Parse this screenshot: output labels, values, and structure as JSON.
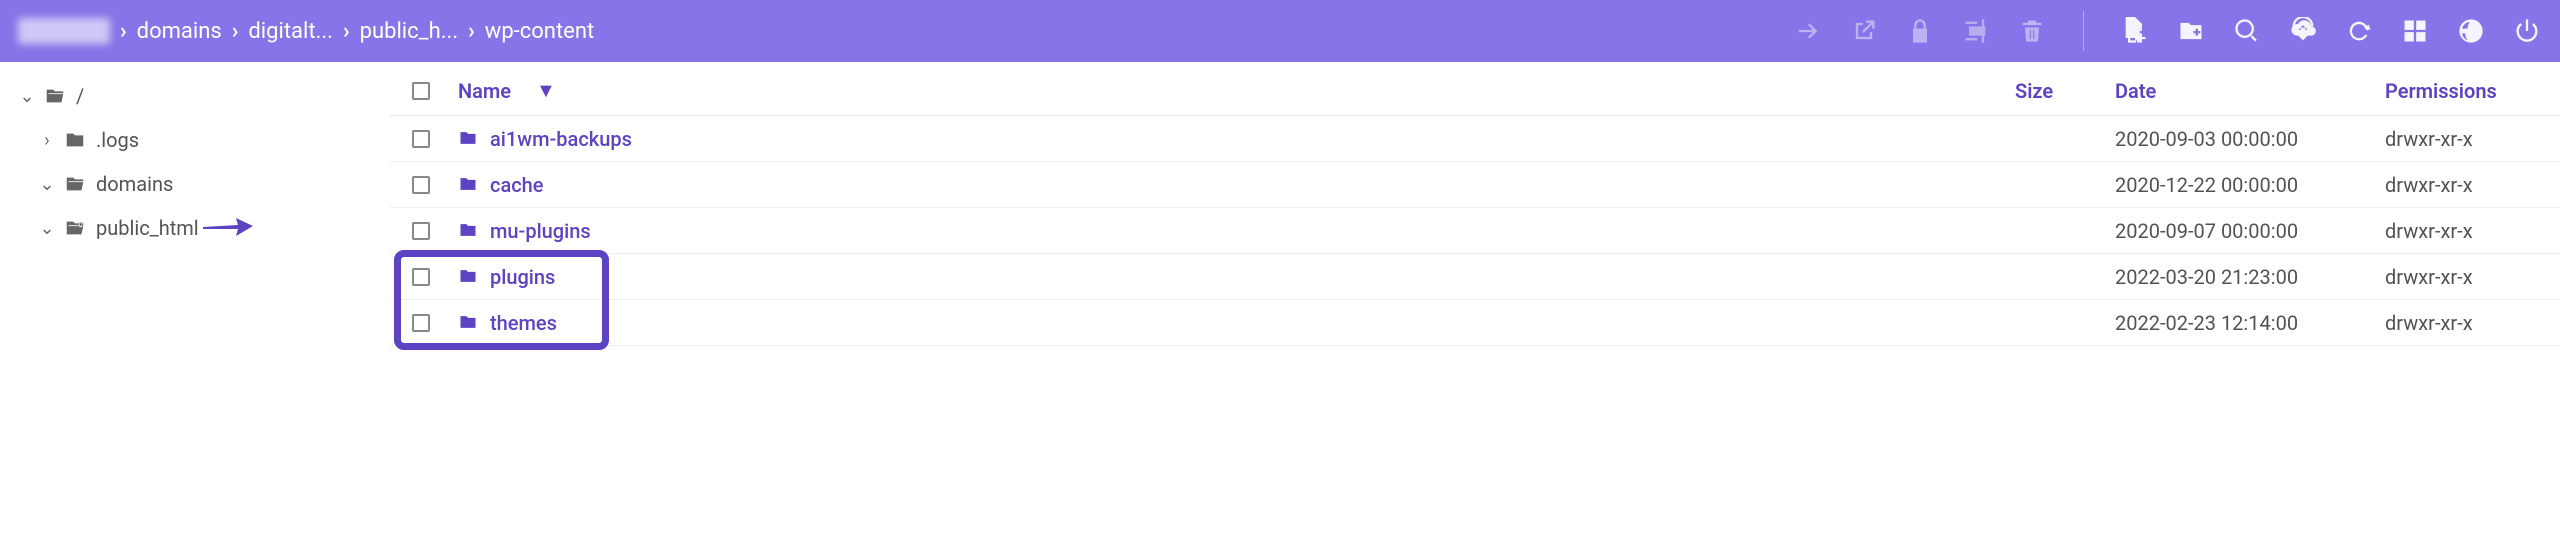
{
  "breadcrumbs": [
    "domains",
    "digitalt...",
    "public_h...",
    "wp-content"
  ],
  "tree": [
    {
      "toggle": "down",
      "icon": "folder-open",
      "label": "/",
      "indent": 0
    },
    {
      "toggle": "right",
      "icon": "folder",
      "label": ".logs",
      "indent": 1
    },
    {
      "toggle": "down",
      "icon": "folder-open",
      "label": "domains",
      "indent": 1
    },
    {
      "toggle": "down",
      "icon": "folder-open-link",
      "label": "public_html",
      "indent": 1,
      "arrow": true
    }
  ],
  "columns": {
    "name": "Name",
    "size": "Size",
    "date": "Date",
    "perm": "Permissions",
    "sort_indicator": "▼"
  },
  "rows": [
    {
      "name": "ai1wm-backups",
      "size": "",
      "date": "2020-09-03 00:00:00",
      "perm": "drwxr-xr-x"
    },
    {
      "name": "cache",
      "size": "",
      "date": "2020-12-22 00:00:00",
      "perm": "drwxr-xr-x"
    },
    {
      "name": "mu-plugins",
      "size": "",
      "date": "2020-09-07 00:00:00",
      "perm": "drwxr-xr-x"
    },
    {
      "name": "plugins",
      "size": "",
      "date": "2022-03-20 21:23:00",
      "perm": "drwxr-xr-x"
    },
    {
      "name": "themes",
      "size": "",
      "date": "2022-02-23 12:14:00",
      "perm": "drwxr-xr-x"
    }
  ],
  "highlight_rows": [
    3,
    4
  ]
}
